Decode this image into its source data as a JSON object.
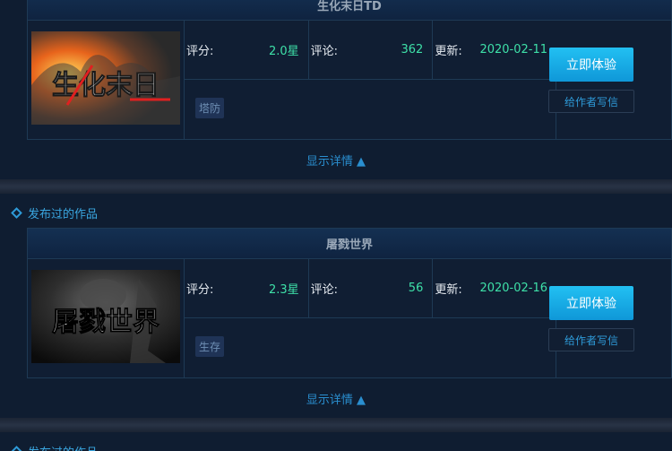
{
  "sections": [
    {
      "title": "发布过的作品",
      "game": {
        "name": "生化末日TD",
        "thumb_text": "生化末日",
        "rating_label": "评分:",
        "rating_value": "2.0星",
        "comments_label": "评论:",
        "comments_value": "362",
        "update_label": "更新:",
        "update_value": "2020-02-11",
        "tag": "塔防",
        "play_button": "立即体验",
        "write_button": "给作者写信",
        "details_link": "显示详情 ▲"
      }
    },
    {
      "title": "发布过的作品",
      "game": {
        "name": "屠戮世界",
        "thumb_text": "屠戮世界",
        "rating_label": "评分:",
        "rating_value": "2.3星",
        "comments_label": "评论:",
        "comments_value": "56",
        "update_label": "更新:",
        "update_value": "2020-02-16",
        "tag": "生存",
        "play_button": "立即体验",
        "write_button": "给作者写信",
        "details_link": "显示详情 ▲"
      }
    },
    {
      "title": "发布过的作品"
    }
  ],
  "colors": {
    "accent": "#2e9ad8",
    "stat_value": "#3ee0a8",
    "play_button": "#1aaee8"
  }
}
